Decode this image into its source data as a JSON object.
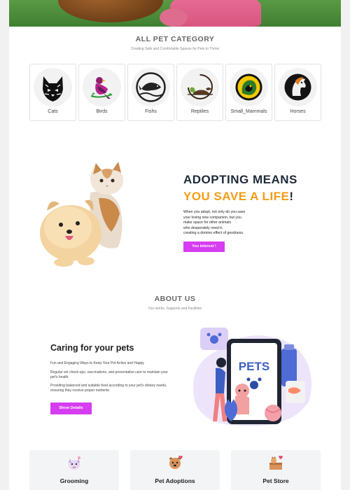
{
  "categories_section": {
    "title": "ALL PET CATEGORY",
    "subtitle": "Creating Safe and Comfortable Spaces for Pets to Thrive",
    "items": [
      {
        "label": "Cats",
        "icon": "cat-icon"
      },
      {
        "label": "Birds",
        "icon": "bird-icon"
      },
      {
        "label": "Fishs",
        "icon": "fish-icon"
      },
      {
        "label": "Reptiles",
        "icon": "reptile-icon"
      },
      {
        "label": "Small_Mammals",
        "icon": "small-mammal-icon"
      },
      {
        "label": "Horses",
        "icon": "horse-icon"
      }
    ]
  },
  "adopt_section": {
    "heading_line1": "ADOPTING MEANS",
    "heading_line2": "YOU SAVE A LIFE",
    "heading_bang": "!",
    "lines": [
      "When you adopt, not only do you save",
      "your loving new companion, but you",
      "make space for other animals",
      "who desperately need it,",
      "creating a domino effect of goodness."
    ],
    "button_label": "You interest !"
  },
  "about_section": {
    "title": "ABOUT US",
    "subtitle": "Our works, Supports and Facilities"
  },
  "caring_section": {
    "heading": "Caring for your pets",
    "p1": "Fun and Engaging Ways to Keep Your Pet Active and Happy",
    "p2": "Regular vet check-ups, vaccinations, and preventative care to maintain your pet's health.",
    "p3": "Providing balanced and suitable food according to your pet's dietary needs, ensuring they receive proper nutrients.",
    "button_label": "Show Details",
    "illustration_text": "PETS"
  },
  "services": [
    {
      "title": "Grooming",
      "icon": "grooming-icon"
    },
    {
      "title": "Pet Adoptions",
      "icon": "pet-adoption-icon"
    },
    {
      "title": "Pet Store",
      "icon": "pet-store-icon"
    }
  ],
  "colors": {
    "accent_pink": "#d63cf0",
    "accent_orange": "#f39c12",
    "heading_dark": "#1e2a3a"
  }
}
